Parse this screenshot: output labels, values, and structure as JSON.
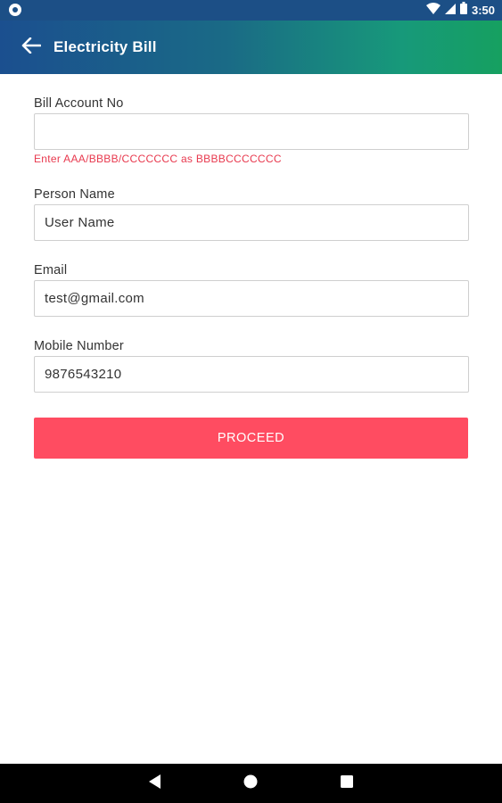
{
  "status_bar": {
    "time": "3:50",
    "icons": [
      "notification-dot-icon",
      "wifi-icon",
      "signal-icon",
      "battery-icon"
    ]
  },
  "app_bar": {
    "title": "Electricity Bill",
    "back_icon": "arrow-left-icon"
  },
  "form": {
    "bill_account": {
      "label": "Bill Account No",
      "value": "",
      "hint": "Enter AAA/BBBB/CCCCCCC as BBBBCCCCCCC"
    },
    "person_name": {
      "label": "Person Name",
      "value": "User Name"
    },
    "email": {
      "label": "Email",
      "value": "test@gmail.com"
    },
    "mobile": {
      "label": "Mobile Number",
      "value": "9876543210"
    },
    "proceed_label": "PROCEED"
  },
  "nav_bar": {
    "icons": [
      "back-triangle-icon",
      "home-circle-icon",
      "recents-square-icon"
    ]
  },
  "colors": {
    "status_bar": "#1c4f86",
    "app_bar_start": "#1b4f8f",
    "app_bar_end": "#16a060",
    "accent_button": "#ff4c61",
    "hint_text": "#e8394e"
  }
}
